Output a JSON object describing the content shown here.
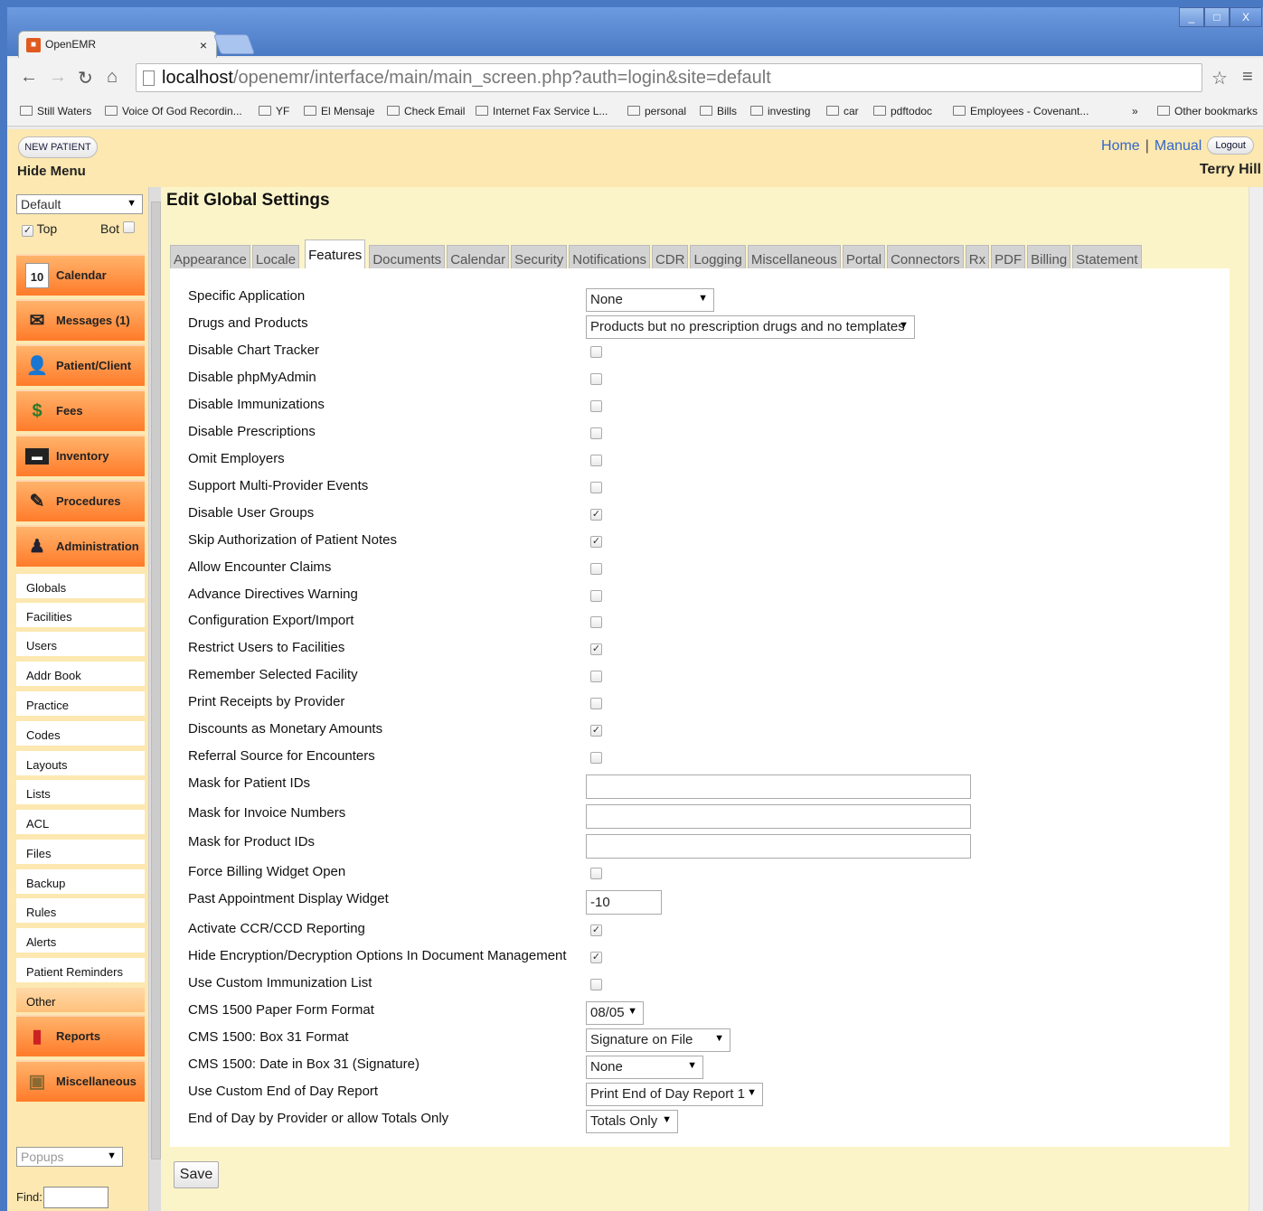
{
  "browser": {
    "tab_title": "OpenEMR",
    "tab_close": "×",
    "url_host": "localhost",
    "url_path": "/openemr/interface/main/main_screen.php?auth=login&site=default",
    "window_buttons": [
      "_",
      "□",
      "X"
    ],
    "bookmarks": [
      "Still Waters",
      "Voice Of God Recordin...",
      "YF",
      "El Mensaje",
      "Check Email",
      "Internet Fax Service L...",
      "personal",
      "Bills",
      "investing",
      "car",
      "pdftodoc",
      "Employees - Covenant..."
    ],
    "bookmarks_more": "»",
    "other_bookmarks": "Other bookmarks"
  },
  "header": {
    "new_patient": "NEW PATIENT",
    "hide_menu": "Hide Menu",
    "home": "Home",
    "separator": "|",
    "manual": "Manual",
    "logout": "Logout",
    "user": "Terry Hill"
  },
  "leftnav": {
    "layout_select": "Default",
    "top_label": "Top",
    "bot_label": "Bot",
    "top_checked": true,
    "bot_checked": false,
    "nav_buttons": [
      {
        "label": "Calendar",
        "icon": "calendar-icon"
      },
      {
        "label": "Messages (1)",
        "icon": "envelope-icon"
      },
      {
        "label": "Patient/Client",
        "icon": "person-icon"
      },
      {
        "label": "Fees",
        "icon": "money-icon"
      },
      {
        "label": "Inventory",
        "icon": "inventory-icon"
      },
      {
        "label": "Procedures",
        "icon": "syringe-icon"
      },
      {
        "label": "Administration",
        "icon": "admin-icon"
      }
    ],
    "admin_items": [
      "Globals",
      "Facilities",
      "Users",
      "Addr Book",
      "Practice",
      "Codes",
      "Layouts",
      "Lists",
      "ACL",
      "Files",
      "Backup",
      "Rules",
      "Alerts",
      "Patient Reminders"
    ],
    "other": "Other",
    "reports": "Reports",
    "miscellaneous": "Miscellaneous",
    "popups_select": "Popups",
    "find_label": "Find:"
  },
  "content": {
    "title": "Edit Global Settings",
    "tabs": [
      "Appearance",
      "Locale",
      "Features",
      "Documents",
      "Calendar",
      "Security",
      "Notifications",
      "CDR",
      "Logging",
      "Miscellaneous",
      "Portal",
      "Connectors",
      "Rx",
      "PDF",
      "Billing",
      "Statement"
    ],
    "active_tab": "Features",
    "settings": [
      {
        "label": "Specific Application",
        "type": "select",
        "value": "None"
      },
      {
        "label": "Drugs and Products",
        "type": "select",
        "value": "Products but no prescription drugs and no templates"
      },
      {
        "label": "Disable Chart Tracker",
        "type": "checkbox",
        "checked": false
      },
      {
        "label": "Disable phpMyAdmin",
        "type": "checkbox",
        "checked": false
      },
      {
        "label": "Disable Immunizations",
        "type": "checkbox",
        "checked": false
      },
      {
        "label": "Disable Prescriptions",
        "type": "checkbox",
        "checked": false
      },
      {
        "label": "Omit Employers",
        "type": "checkbox",
        "checked": false
      },
      {
        "label": "Support Multi-Provider Events",
        "type": "checkbox",
        "checked": false
      },
      {
        "label": "Disable User Groups",
        "type": "checkbox",
        "checked": true
      },
      {
        "label": "Skip Authorization of Patient Notes",
        "type": "checkbox",
        "checked": true
      },
      {
        "label": "Allow Encounter Claims",
        "type": "checkbox",
        "checked": false
      },
      {
        "label": "Advance Directives Warning",
        "type": "checkbox",
        "checked": false
      },
      {
        "label": "Configuration Export/Import",
        "type": "checkbox",
        "checked": false
      },
      {
        "label": "Restrict Users to Facilities",
        "type": "checkbox",
        "checked": true
      },
      {
        "label": "Remember Selected Facility",
        "type": "checkbox",
        "checked": false
      },
      {
        "label": "Print Receipts by Provider",
        "type": "checkbox",
        "checked": false
      },
      {
        "label": "Discounts as Monetary Amounts",
        "type": "checkbox",
        "checked": true
      },
      {
        "label": "Referral Source for Encounters",
        "type": "checkbox",
        "checked": false
      },
      {
        "label": "Mask for Patient IDs",
        "type": "text",
        "value": ""
      },
      {
        "label": "Mask for Invoice Numbers",
        "type": "text",
        "value": ""
      },
      {
        "label": "Mask for Product IDs",
        "type": "text",
        "value": ""
      },
      {
        "label": "Force Billing Widget Open",
        "type": "checkbox",
        "checked": false
      },
      {
        "label": "Past Appointment Display Widget",
        "type": "text",
        "value": "-10"
      },
      {
        "label": "Activate CCR/CCD Reporting",
        "type": "checkbox",
        "checked": true
      },
      {
        "label": "Hide Encryption/Decryption Options In Document Management",
        "type": "checkbox",
        "checked": true
      },
      {
        "label": "Use Custom Immunization List",
        "type": "checkbox",
        "checked": false
      },
      {
        "label": "CMS 1500 Paper Form Format",
        "type": "select",
        "value": "08/05"
      },
      {
        "label": "CMS 1500: Box 31 Format",
        "type": "select",
        "value": "Signature on File"
      },
      {
        "label": "CMS 1500: Date in Box 31 (Signature)",
        "type": "select",
        "value": "None"
      },
      {
        "label": "Use Custom End of Day Report",
        "type": "select",
        "value": "Print End of Day Report 1"
      },
      {
        "label": "End of Day by Provider or allow Totals Only",
        "type": "select",
        "value": "Totals Only"
      }
    ],
    "save": "Save"
  }
}
